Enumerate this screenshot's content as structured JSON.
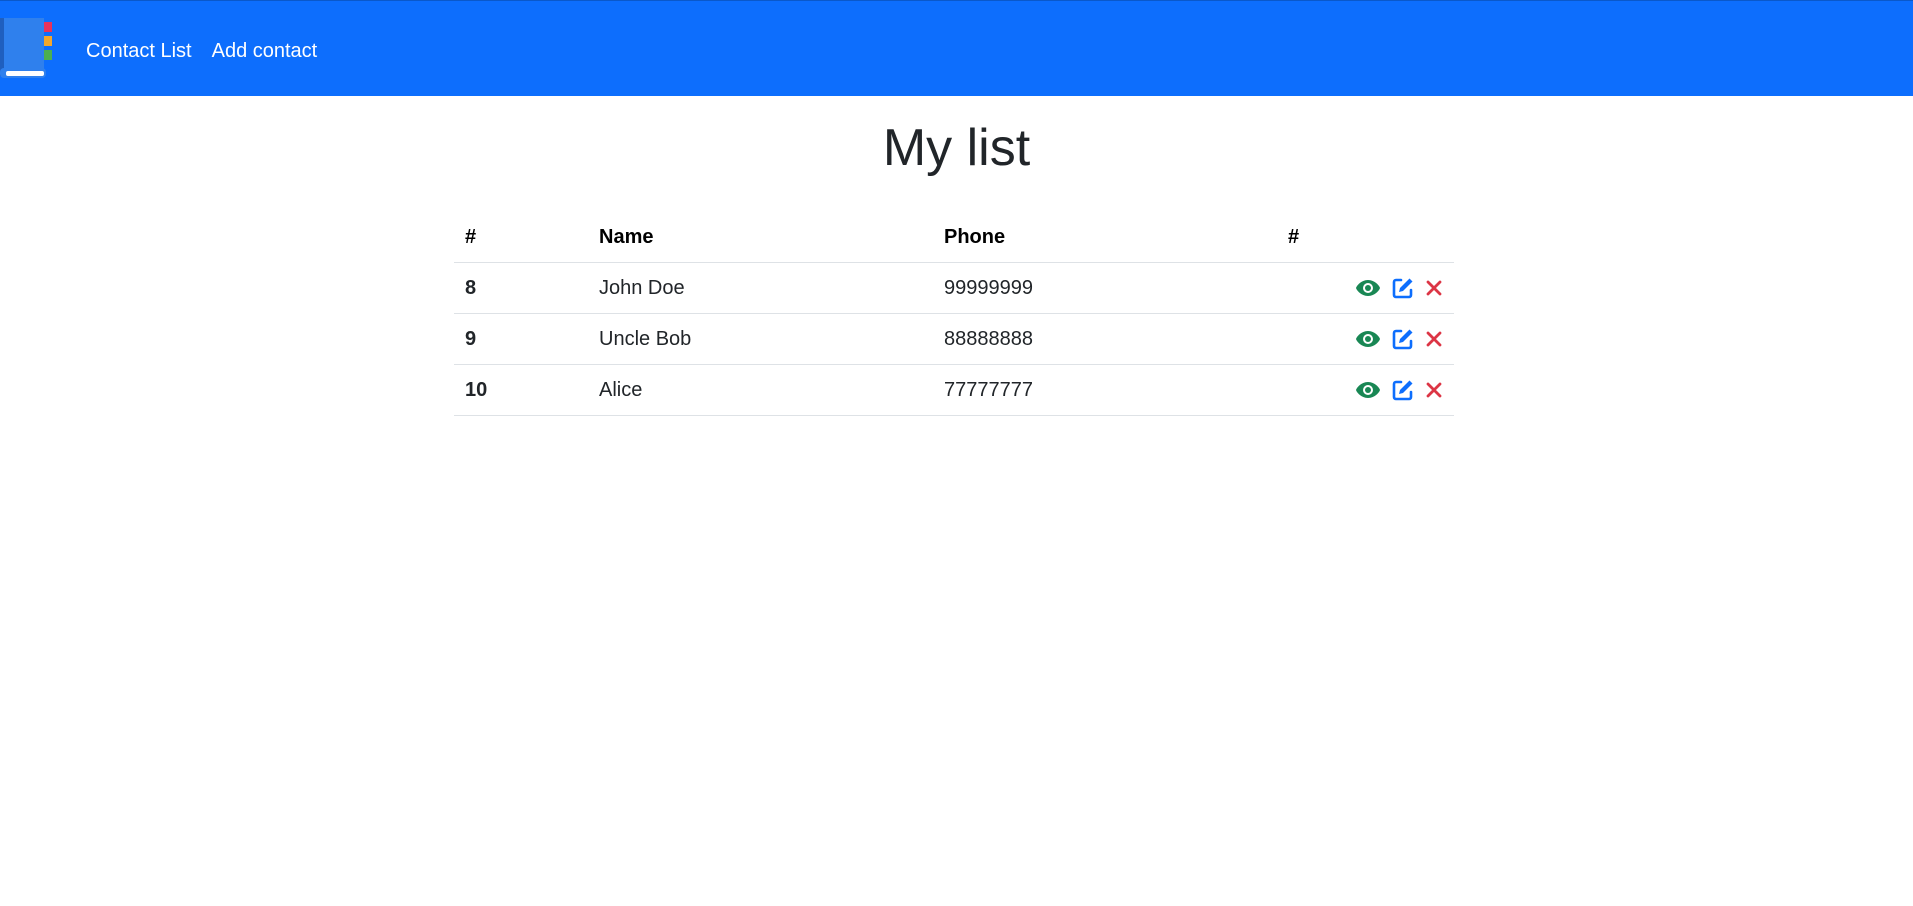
{
  "nav": {
    "brand_icon": "address-book-icon",
    "links": [
      {
        "label": "Contact List"
      },
      {
        "label": "Add contact"
      }
    ],
    "color": "#0d6efd"
  },
  "page": {
    "title": "My list"
  },
  "table": {
    "headers": [
      "#",
      "Name",
      "Phone",
      "#"
    ],
    "rows": [
      {
        "id": "8",
        "name": "John Doe",
        "phone": "99999999"
      },
      {
        "id": "9",
        "name": "Uncle Bob",
        "phone": "88888888"
      },
      {
        "id": "10",
        "name": "Alice",
        "phone": "77777777"
      }
    ],
    "actions": [
      {
        "icon": "eye-icon",
        "color": "#198754"
      },
      {
        "icon": "edit-icon",
        "color": "#0d6efd"
      },
      {
        "icon": "close-icon",
        "color": "#dc3545"
      }
    ]
  }
}
